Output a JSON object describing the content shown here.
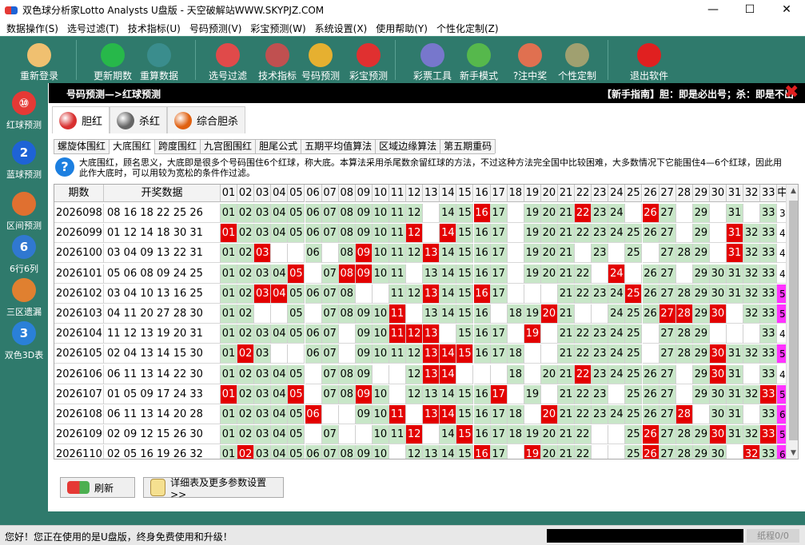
{
  "window": {
    "title": "双色球分析家Lotto Analysts U盘版 - 天空破解站WWW.SKYPJZ.COM",
    "min": "—",
    "max": "☐",
    "close": "✕"
  },
  "menu": [
    "数据操作(S)",
    "选号过滤(T)",
    "技术指标(U)",
    "号码预测(V)",
    "彩宝预测(W)",
    "系统设置(X)",
    "使用帮助(Y)",
    "个性化定制(Z)"
  ],
  "toolbar": [
    {
      "label": "重新登录",
      "icon": "user-icon",
      "color": "#f0c070"
    },
    {
      "label": "更新期数",
      "icon": "plus-icon",
      "color": "#27b84a"
    },
    {
      "label": "重算数据",
      "icon": "refresh-icon",
      "color": "#3a8d8d"
    },
    {
      "label": "选号过滤",
      "icon": "pie-icon",
      "color": "#e04a4a"
    },
    {
      "label": "技术指标",
      "icon": "chart-icon",
      "color": "#c05050"
    },
    {
      "label": "号码预测",
      "icon": "forecast-icon",
      "color": "#e6b030"
    },
    {
      "label": "彩宝预测",
      "icon": "treasure-icon",
      "color": "#e03030"
    },
    {
      "label": "彩票工具",
      "icon": "shop-icon",
      "color": "#7777cc"
    },
    {
      "label": "新手模式",
      "icon": "chat-icon",
      "color": "#56b84c"
    },
    {
      "label": "?注中奖",
      "icon": "prize-icon",
      "color": "#e07050"
    },
    {
      "label": "个性定制",
      "icon": "clipboard-icon",
      "color": "#a0a070"
    },
    {
      "label": "退出软件",
      "icon": "exit-icon",
      "color": "#e02020"
    }
  ],
  "sidebar": [
    {
      "label": "红球预测",
      "icon": "red-ball-icon",
      "glyph": "⑩",
      "color": "#e53935"
    },
    {
      "label": "蓝球预测",
      "icon": "blue-ball-icon",
      "glyph": "2",
      "color": "#1e63d6"
    },
    {
      "label": "区间预测",
      "icon": "pie-ball-icon",
      "glyph": "",
      "color": "#e07030"
    },
    {
      "label": "6行6列",
      "icon": "six-icon",
      "glyph": "6",
      "color": "#3078d0"
    },
    {
      "label": "三区遗漏",
      "icon": "bars-icon",
      "glyph": "",
      "color": "#e08030"
    },
    {
      "label": "双色3D表",
      "icon": "3d-ball-icon",
      "glyph": "3",
      "color": "#2a80d8"
    }
  ],
  "panel": {
    "breadcrumb": "号码预测—>红球预测",
    "guide": "【新手指南】胆：即是必出号；杀：即是不出号。",
    "close": "✖"
  },
  "tabs1": [
    {
      "label": "胆红",
      "color": "#d83030"
    },
    {
      "label": "杀红",
      "color": "#666666"
    },
    {
      "label": "综合胆杀",
      "color": "#e06010"
    }
  ],
  "tabs2": [
    "螺旋体围红",
    "大底围红",
    "跨度围红",
    "九宫图围红",
    "胆尾公式",
    "五期平均值算法",
    "区域边缘算法",
    "第五期重码"
  ],
  "info": "大底围红，顾名思义，大底即是很多个号码围住6个红球，称大底。本算法采用杀尾数余留红球的方法，不过这种方法完全国中比较困难，大多数情况下它能围住4—6个红球，因此用此作大底时，可以用较为宽松的条件作过滤。",
  "grid": {
    "col_period": "期数",
    "col_numbers": "开奖数据",
    "col_last": "中",
    "number_headers": [
      "01",
      "02",
      "03",
      "04",
      "05",
      "06",
      "07",
      "08",
      "09",
      "10",
      "11",
      "12",
      "13",
      "14",
      "15",
      "16",
      "17",
      "18",
      "19",
      "20",
      "21",
      "22",
      "23",
      "24",
      "25",
      "26",
      "27",
      "28",
      "29",
      "30",
      "31",
      "32",
      "33"
    ],
    "rows": [
      {
        "period": "2026098",
        "draw": "08 16 18 22 25 26",
        "hits": [
          "16",
          "22",
          "26"
        ],
        "cands": [
          "01",
          "02",
          "03",
          "04",
          "05",
          "06",
          "07",
          "08",
          "09",
          "10",
          "11",
          "12",
          "14",
          "15",
          "16",
          "17",
          "19",
          "20",
          "21",
          "22",
          "23",
          "24",
          "26",
          "27",
          "29",
          "31",
          "33"
        ],
        "last": "3",
        "lastbg": ""
      },
      {
        "period": "2026099",
        "draw": "01 12 14 18 30 31",
        "hits": [
          "01",
          "12",
          "14",
          "31"
        ],
        "cands": [
          "01",
          "02",
          "03",
          "04",
          "05",
          "06",
          "07",
          "08",
          "09",
          "10",
          "11",
          "12",
          "14",
          "15",
          "16",
          "17",
          "19",
          "20",
          "21",
          "22",
          "23",
          "24",
          "25",
          "26",
          "27",
          "29",
          "31",
          "32",
          "33"
        ],
        "last": "4",
        "lastbg": ""
      },
      {
        "period": "2026100",
        "draw": "03 04 09 13 22 31",
        "hits": [
          "03",
          "09",
          "13",
          "31"
        ],
        "cands": [
          "01",
          "02",
          "03",
          "06",
          "08",
          "09",
          "10",
          "11",
          "12",
          "13",
          "14",
          "15",
          "16",
          "17",
          "19",
          "20",
          "21",
          "23",
          "25",
          "27",
          "28",
          "29",
          "31",
          "32",
          "33"
        ],
        "last": "4",
        "lastbg": ""
      },
      {
        "period": "2026101",
        "draw": "05 06 08 09 24 25",
        "hits": [
          "05",
          "08",
          "09",
          "24"
        ],
        "cands": [
          "01",
          "02",
          "03",
          "04",
          "05",
          "07",
          "08",
          "09",
          "10",
          "11",
          "13",
          "14",
          "15",
          "16",
          "17",
          "19",
          "20",
          "21",
          "22",
          "24",
          "26",
          "27",
          "29",
          "30",
          "31",
          "32",
          "33"
        ],
        "last": "4",
        "lastbg": ""
      },
      {
        "period": "2026102",
        "draw": "03 04 10 13 16 25",
        "hits": [
          "03",
          "04",
          "13",
          "16",
          "25"
        ],
        "cands": [
          "01",
          "02",
          "03",
          "04",
          "05",
          "06",
          "07",
          "08",
          "11",
          "12",
          "13",
          "14",
          "15",
          "16",
          "17",
          "21",
          "22",
          "23",
          "24",
          "25",
          "26",
          "27",
          "28",
          "29",
          "30",
          "31",
          "32",
          "33"
        ],
        "last": "5",
        "lastbg": "#ff33ff"
      },
      {
        "period": "2026103",
        "draw": "04 11 20 27 28 30",
        "hits": [
          "11",
          "20",
          "27",
          "28",
          "30"
        ],
        "cands": [
          "01",
          "02",
          "05",
          "07",
          "08",
          "09",
          "10",
          "11",
          "13",
          "14",
          "15",
          "16",
          "18",
          "19",
          "20",
          "21",
          "24",
          "25",
          "26",
          "27",
          "28",
          "29",
          "30",
          "32",
          "33"
        ],
        "last": "5",
        "lastbg": "#ff33ff"
      },
      {
        "period": "2026104",
        "draw": "11 12 13 19 20 31",
        "hits": [
          "11",
          "12",
          "13",
          "19"
        ],
        "cands": [
          "01",
          "02",
          "03",
          "04",
          "05",
          "06",
          "07",
          "09",
          "10",
          "11",
          "12",
          "13",
          "15",
          "16",
          "17",
          "19",
          "21",
          "22",
          "23",
          "24",
          "25",
          "27",
          "28",
          "29",
          "33"
        ],
        "last": "4",
        "lastbg": ""
      },
      {
        "period": "2026105",
        "draw": "02 04 13 14 15 30",
        "hits": [
          "02",
          "13",
          "14",
          "15",
          "30"
        ],
        "cands": [
          "01",
          "02",
          "03",
          "06",
          "07",
          "09",
          "10",
          "11",
          "12",
          "13",
          "14",
          "15",
          "16",
          "17",
          "18",
          "21",
          "22",
          "23",
          "24",
          "25",
          "27",
          "28",
          "29",
          "30",
          "31",
          "32",
          "33"
        ],
        "last": "5",
        "lastbg": "#ff33ff"
      },
      {
        "period": "2026106",
        "draw": "06 11 13 14 22 30",
        "hits": [
          "13",
          "14",
          "22",
          "30"
        ],
        "cands": [
          "01",
          "02",
          "03",
          "04",
          "05",
          "07",
          "08",
          "09",
          "12",
          "13",
          "14",
          "18",
          "20",
          "21",
          "22",
          "23",
          "24",
          "25",
          "26",
          "27",
          "29",
          "30",
          "31",
          "33"
        ],
        "last": "4",
        "lastbg": ""
      },
      {
        "period": "2026107",
        "draw": "01 05 09 17 24 33",
        "hits": [
          "01",
          "05",
          "09",
          "17",
          "33"
        ],
        "cands": [
          "01",
          "02",
          "03",
          "04",
          "05",
          "07",
          "08",
          "09",
          "10",
          "12",
          "13",
          "14",
          "15",
          "16",
          "17",
          "19",
          "21",
          "22",
          "23",
          "25",
          "26",
          "27",
          "29",
          "30",
          "31",
          "32",
          "33"
        ],
        "last": "5",
        "lastbg": "#ff33ff"
      },
      {
        "period": "2026108",
        "draw": "06 11 13 14 20 28",
        "hits": [
          "06",
          "11",
          "13",
          "14",
          "20",
          "28"
        ],
        "cands": [
          "01",
          "02",
          "03",
          "04",
          "05",
          "06",
          "09",
          "10",
          "11",
          "13",
          "14",
          "15",
          "16",
          "17",
          "18",
          "20",
          "21",
          "22",
          "23",
          "24",
          "25",
          "26",
          "27",
          "28",
          "30",
          "31",
          "33"
        ],
        "last": "6",
        "lastbg": "#ff33ff"
      },
      {
        "period": "2026109",
        "draw": "02 09 12 15 26 30",
        "hits": [
          "12",
          "15",
          "26",
          "30",
          "33"
        ],
        "cands": [
          "01",
          "02",
          "03",
          "04",
          "05",
          "07",
          "10",
          "11",
          "12",
          "14",
          "15",
          "16",
          "17",
          "18",
          "19",
          "20",
          "21",
          "22",
          "25",
          "26",
          "27",
          "28",
          "29",
          "30",
          "31",
          "32",
          "33"
        ],
        "last": "5",
        "lastbg": "#ff33ff"
      },
      {
        "period": "2026110",
        "draw": "02 05 16 19 26 32",
        "hits": [
          "02",
          "16",
          "19",
          "26",
          "32"
        ],
        "cands": [
          "01",
          "02",
          "03",
          "04",
          "05",
          "06",
          "07",
          "08",
          "09",
          "10",
          "12",
          "13",
          "14",
          "15",
          "16",
          "17",
          "19",
          "20",
          "21",
          "22",
          "25",
          "26",
          "27",
          "28",
          "29",
          "30",
          "32",
          "33"
        ],
        "last": "6",
        "lastbg": "#ff33ff"
      }
    ]
  },
  "buttons": {
    "refresh": "刷新",
    "more": "详细表及更多参数设置>>"
  },
  "status": {
    "message": "您好！您正在使用的是U盘版，终身免费使用和升级！",
    "page": "纸程0/0"
  }
}
